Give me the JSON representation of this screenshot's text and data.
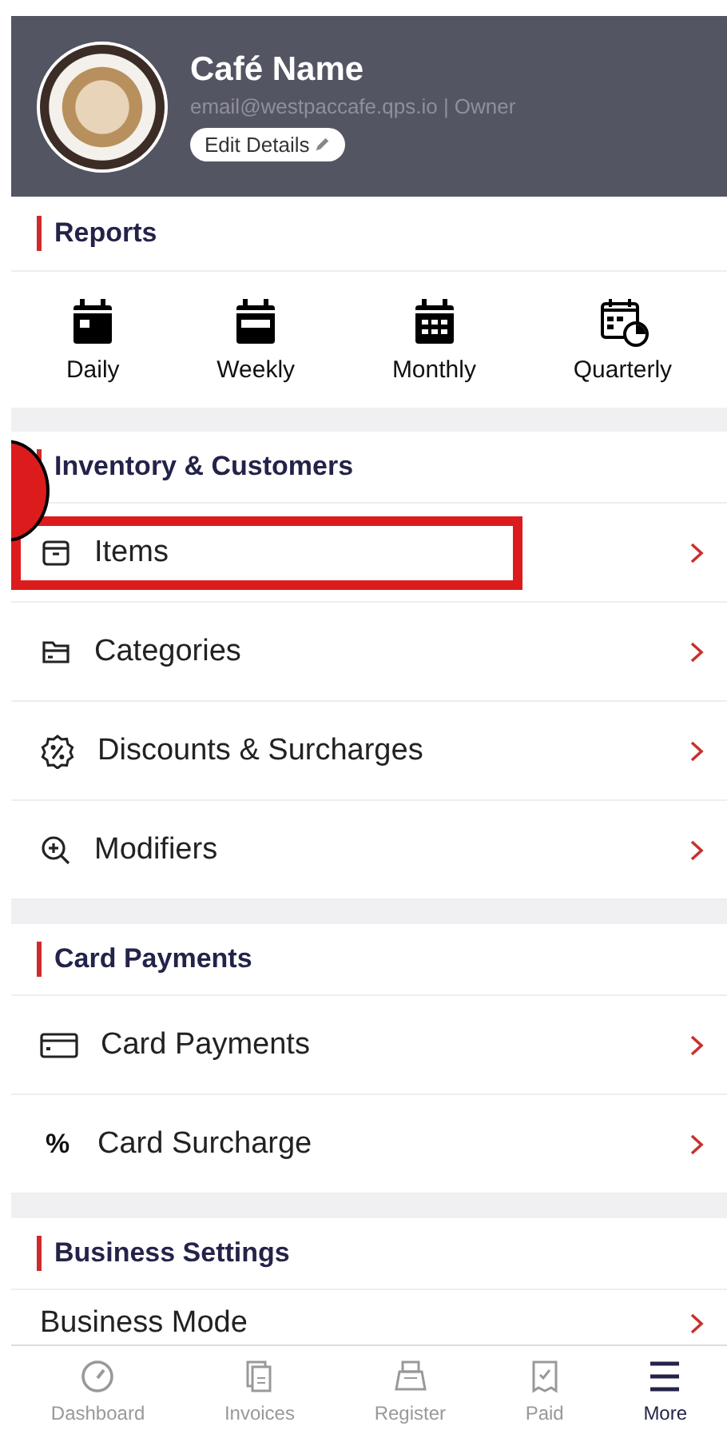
{
  "profile": {
    "name": "Café Name",
    "subtitle": "email@westpaccafe.qps.io | Owner",
    "edit_button": "Edit Details"
  },
  "reports": {
    "title": "Reports",
    "items": [
      {
        "label": "Daily",
        "kind": "daily"
      },
      {
        "label": "Weekly",
        "kind": "weekly"
      },
      {
        "label": "Monthly",
        "kind": "monthly"
      },
      {
        "label": "Quarterly",
        "kind": "quarterly"
      }
    ]
  },
  "sections": [
    {
      "title": "Inventory & Customers",
      "rows": [
        {
          "label": "Items",
          "kind": "box",
          "highlighted": true
        },
        {
          "label": "Categories",
          "kind": "folder",
          "highlighted": false
        },
        {
          "label": "Discounts & Surcharges",
          "kind": "discount",
          "highlighted": false
        },
        {
          "label": "Modifiers",
          "kind": "zoom",
          "highlighted": false
        }
      ]
    },
    {
      "title": "Card Payments",
      "rows": [
        {
          "label": "Card Payments",
          "kind": "card",
          "highlighted": false
        },
        {
          "label": "Card Surcharge",
          "kind": "percent",
          "icon_text": "%",
          "highlighted": false
        }
      ]
    },
    {
      "title": "Business Settings",
      "rows": [
        {
          "label": "Business Mode",
          "kind": "none",
          "highlighted": false
        }
      ]
    }
  ],
  "tab_bar": [
    {
      "label": "Dashboard",
      "kind": "gauge",
      "selected": false
    },
    {
      "label": "Invoices",
      "kind": "docs",
      "selected": false
    },
    {
      "label": "Register",
      "kind": "register",
      "selected": false
    },
    {
      "label": "Paid",
      "kind": "receipt",
      "selected": false
    },
    {
      "label": "More",
      "kind": "menu",
      "selected": true
    }
  ]
}
